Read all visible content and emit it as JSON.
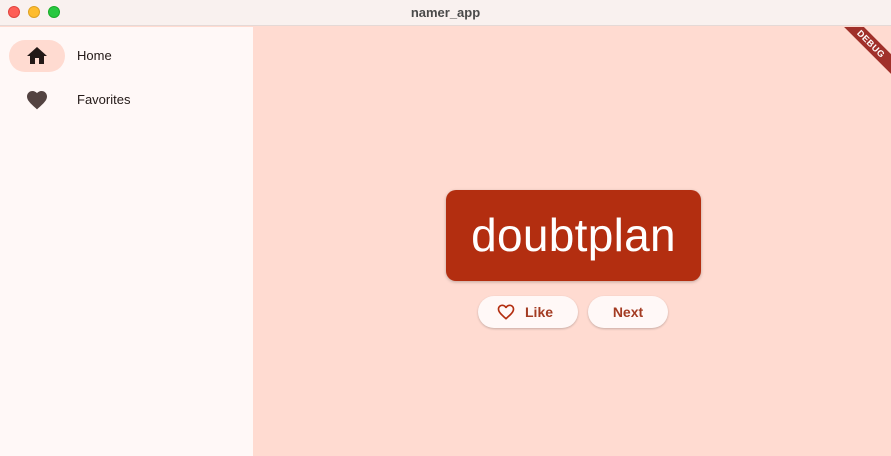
{
  "window": {
    "title": "namer_app"
  },
  "sidebar": {
    "items": [
      {
        "label": "Home",
        "icon": "home-icon",
        "selected": true
      },
      {
        "label": "Favorites",
        "icon": "heart-icon",
        "selected": false
      }
    ]
  },
  "main": {
    "word": "doubtplan",
    "like_label": "Like",
    "next_label": "Next"
  },
  "debug_banner": {
    "label": "DEBUG"
  },
  "colors": {
    "primary": "#b32e10",
    "background": "#ffdbd1",
    "sidebar": "#fff8f7",
    "button_text": "#a33b22"
  }
}
